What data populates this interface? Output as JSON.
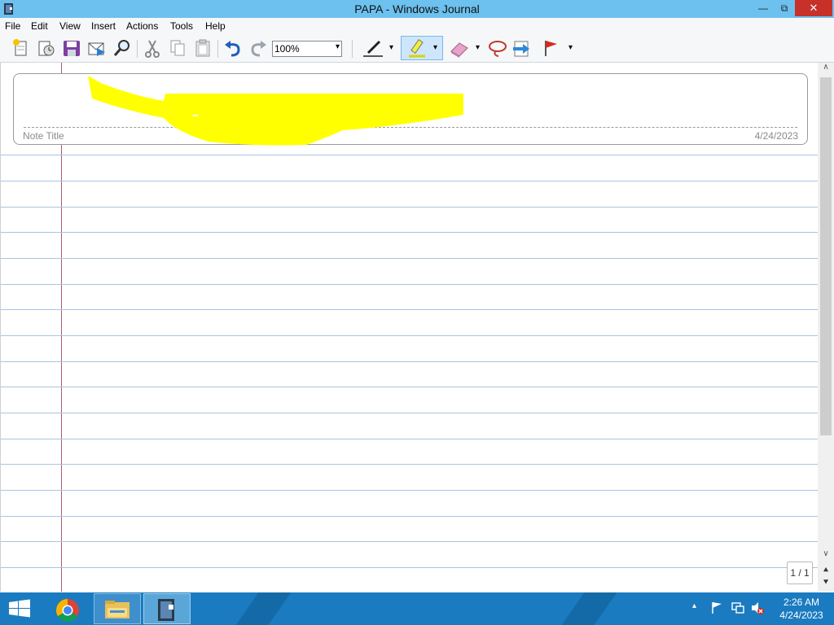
{
  "window": {
    "title": "PAPA - Windows Journal",
    "minimize_glyph": "—",
    "maximize_glyph": "⧉",
    "close_glyph": "✕"
  },
  "menu": {
    "items": [
      {
        "label": "File"
      },
      {
        "label": "Edit"
      },
      {
        "label": "View"
      },
      {
        "label": "Insert"
      },
      {
        "label": "Actions"
      },
      {
        "label": "Tools"
      },
      {
        "label": "Help"
      }
    ]
  },
  "toolbar": {
    "icons": [
      "new-note-icon",
      "new-note-from-template-icon",
      "save-icon",
      "send-email-icon",
      "find-icon",
      "cut-icon",
      "copy-icon",
      "paste-icon",
      "undo-icon",
      "redo-icon",
      "pen-icon",
      "highlighter-icon",
      "eraser-icon",
      "lasso-select-icon",
      "insert-move-space-icon",
      "flag-icon"
    ],
    "zoom_value": "100%",
    "dropdown_glyph": "▾"
  },
  "note": {
    "title_label": "Note Title",
    "date": "4/24/2023",
    "highlight_color": "#ffff00",
    "rule_line_color": "#a9c4e0",
    "margin_line_color": "#b3577f"
  },
  "scrollbar": {
    "up_glyph": "∧",
    "down_glyph": "∨"
  },
  "pagination": {
    "page_indicator": "1 / 1",
    "prev_glyph": "⯅",
    "next_glyph": "⯆"
  },
  "taskbar": {
    "apps": [
      "start-icon",
      "chrome-icon",
      "file-explorer-icon",
      "windows-journal-icon"
    ],
    "tray_up_glyph": "▴",
    "time": "2:26 AM",
    "date": "4/24/2023",
    "color": "#1b7bc0"
  }
}
